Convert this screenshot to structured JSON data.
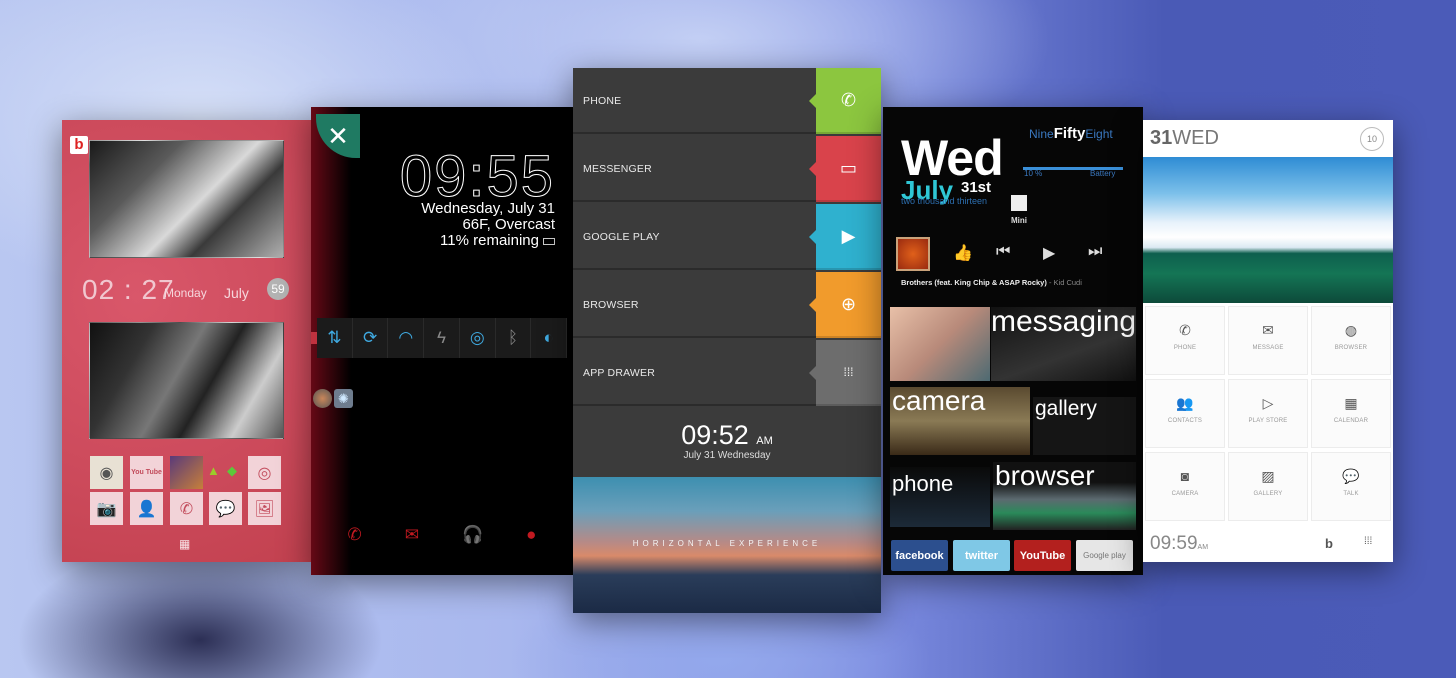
{
  "panels": {
    "red_theme": {
      "logo_glyph": "b",
      "time": "02 : 27",
      "day": "Monday",
      "month": "July",
      "badge": "59",
      "tiles_row1": [
        {
          "icon": "instagram-icon",
          "glyph": "◉"
        },
        {
          "icon": "youtube-icon",
          "glyph": "You Tube"
        },
        {
          "icon": "contact-photo-icon",
          "glyph": ""
        },
        {
          "icon": "android-icon",
          "glyph": "🤖"
        },
        {
          "icon": "chrome-icon",
          "glyph": "◎"
        }
      ],
      "tiles_row2": [
        {
          "icon": "camera-icon",
          "glyph": "📷"
        },
        {
          "icon": "contacts-icon",
          "glyph": "👤"
        },
        {
          "icon": "phone-icon",
          "glyph": "✆"
        },
        {
          "icon": "chat-icon",
          "glyph": "💬"
        },
        {
          "icon": "gallery-icon",
          "glyph": "🖼"
        }
      ],
      "drawer_glyph": "▦"
    },
    "black_theme": {
      "tool_glyph": "✕",
      "time": "09:55",
      "date": "Wednesday, July 31",
      "weather": "66F, Overcast",
      "battery": "11% remaining",
      "quick_settings": [
        {
          "name": "data-toggle-icon",
          "glyph": "⇅",
          "dim": false
        },
        {
          "name": "sync-toggle-icon",
          "glyph": "⟳",
          "dim": false
        },
        {
          "name": "wifi-toggle-icon",
          "glyph": "◠",
          "dim": false
        },
        {
          "name": "flash-toggle-icon",
          "glyph": "ϟ",
          "dim": true
        },
        {
          "name": "gps-toggle-icon",
          "glyph": "◎",
          "dim": false
        },
        {
          "name": "bluetooth-toggle-icon",
          "glyph": "ᛒ",
          "dim": true
        },
        {
          "name": "brightness-toggle-icon",
          "glyph": "◐",
          "dim": false
        }
      ],
      "dock": [
        {
          "name": "phone-icon",
          "glyph": "✆"
        },
        {
          "name": "messages-icon",
          "glyph": "✉"
        },
        {
          "name": "music-icon",
          "glyph": "🎧"
        },
        {
          "name": "browser-icon",
          "glyph": "●"
        }
      ]
    },
    "list_theme": {
      "items": [
        {
          "label": "PHONE",
          "color": "#8cc63f",
          "glyph": "✆",
          "icon": "phone-icon"
        },
        {
          "label": "MESSENGER",
          "color": "#d9434b",
          "glyph": "▭",
          "icon": "message-icon"
        },
        {
          "label": "GOOGLE PLAY",
          "color": "#2fb1cf",
          "glyph": "▶",
          "icon": "play-store-icon"
        },
        {
          "label": "BROWSER",
          "color": "#f19b2c",
          "glyph": "⊕",
          "icon": "globe-icon"
        },
        {
          "label": "APP DRAWER",
          "color": "#6d6d6d",
          "glyph": "⁞⁞⁞",
          "icon": "grid-icon"
        }
      ],
      "time": "09:52",
      "ampm": "AM",
      "date": "July  31  Wednesday",
      "banner": "HORIZONTAL EXPERIENCE"
    },
    "tiles_theme": {
      "day": "Wed",
      "month": "July",
      "date": "31st",
      "year": "two thousand thirteen",
      "clock_pre": "Nine",
      "clock_mid": "Fifty",
      "clock_post": "Eight",
      "battery_value": "10 %",
      "battery_label": "Battery",
      "battery_fraction": 0.1,
      "mini_label": "Mini",
      "song": "Brothers (feat. King Chip & ASAP Rocky)",
      "artist": "- Kid Cudi",
      "tiles": [
        "messaging",
        "camera",
        "gallery",
        "phone",
        "browser"
      ],
      "social": [
        {
          "label": "facebook",
          "color": "#2c4f8e"
        },
        {
          "label": "twitter",
          "color": "#7fc8e6"
        },
        {
          "label": "YouTube",
          "color": "#b3201e"
        },
        {
          "label": "Google play",
          "color": "#e6e6e6"
        }
      ]
    },
    "white_theme": {
      "date_num": "31",
      "date_day": "WED",
      "ring": "10",
      "apps": [
        {
          "label": "PHONE",
          "glyph": "✆",
          "icon": "phone-icon"
        },
        {
          "label": "MESSAGE",
          "glyph": "✉",
          "icon": "message-icon"
        },
        {
          "label": "BROWSER",
          "glyph": "◍",
          "icon": "browser-icon"
        },
        {
          "label": "CONTACTS",
          "glyph": "👥",
          "icon": "contacts-icon"
        },
        {
          "label": "PLAY STORE",
          "glyph": "▷",
          "icon": "play-store-icon"
        },
        {
          "label": "CALENDAR",
          "glyph": "▦",
          "icon": "calendar-icon"
        },
        {
          "label": "CAMERA",
          "glyph": "◙",
          "icon": "camera-icon"
        },
        {
          "label": "GALLERY",
          "glyph": "▨",
          "icon": "gallery-icon"
        },
        {
          "label": "TALK",
          "glyph": "💬",
          "icon": "talk-icon"
        }
      ],
      "time": "09:59",
      "ampm": "AM",
      "logo_glyph": "b",
      "drawer_glyph": "⁞⁞⁞"
    }
  }
}
